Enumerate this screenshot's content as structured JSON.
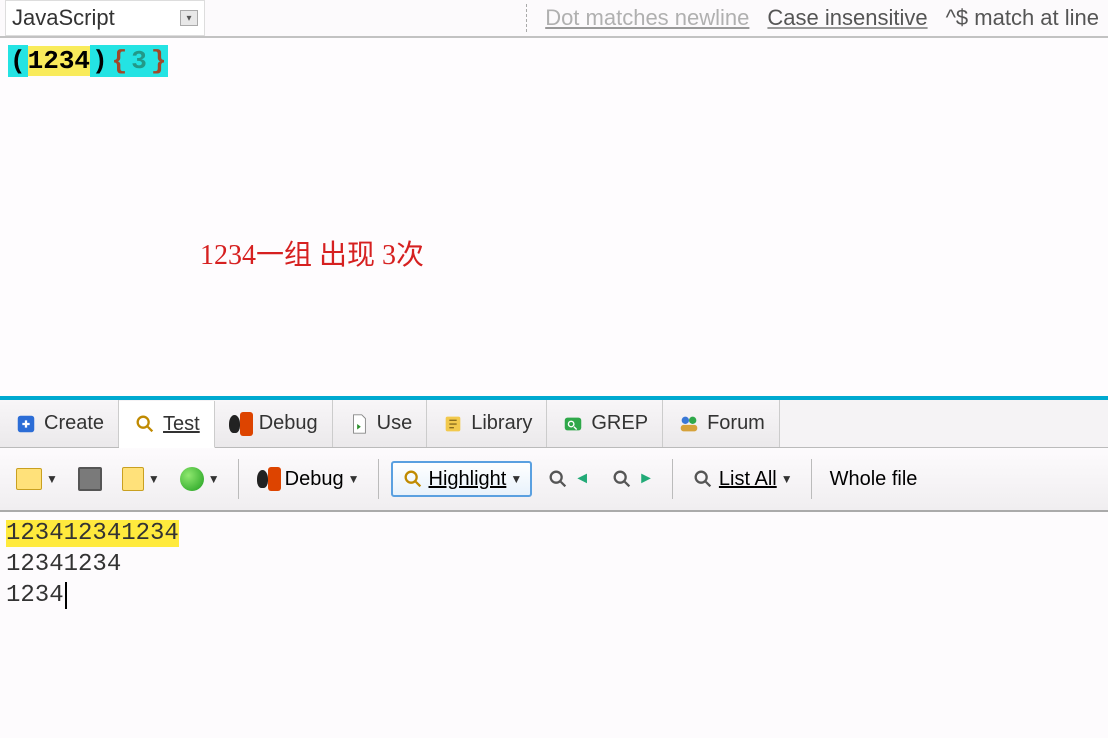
{
  "top": {
    "flavor": "JavaScript",
    "flags": {
      "dot_newline": "Dot matches newline",
      "case_insensitive": "Case insensitive",
      "line_anchors": "^$ match at line "
    }
  },
  "regex": {
    "open_paren": "(",
    "digits": "1234",
    "close_paren": ")",
    "brace_open": "{",
    "brace_num": "3",
    "brace_close": "}"
  },
  "annotation": "1234一组 出现 3次",
  "tabs": {
    "create": "Create",
    "test": "Test",
    "debug": "Debug",
    "use": "Use",
    "library": "Library",
    "grep": "GREP",
    "forum": "Forum"
  },
  "toolbar": {
    "debug_label": "Debug",
    "highlight_label": "Highlight",
    "list_all": "List All",
    "whole_file": "Whole file"
  },
  "test_text": {
    "line1_match": "123412341234",
    "line2": "12341234",
    "line3": "1234"
  }
}
